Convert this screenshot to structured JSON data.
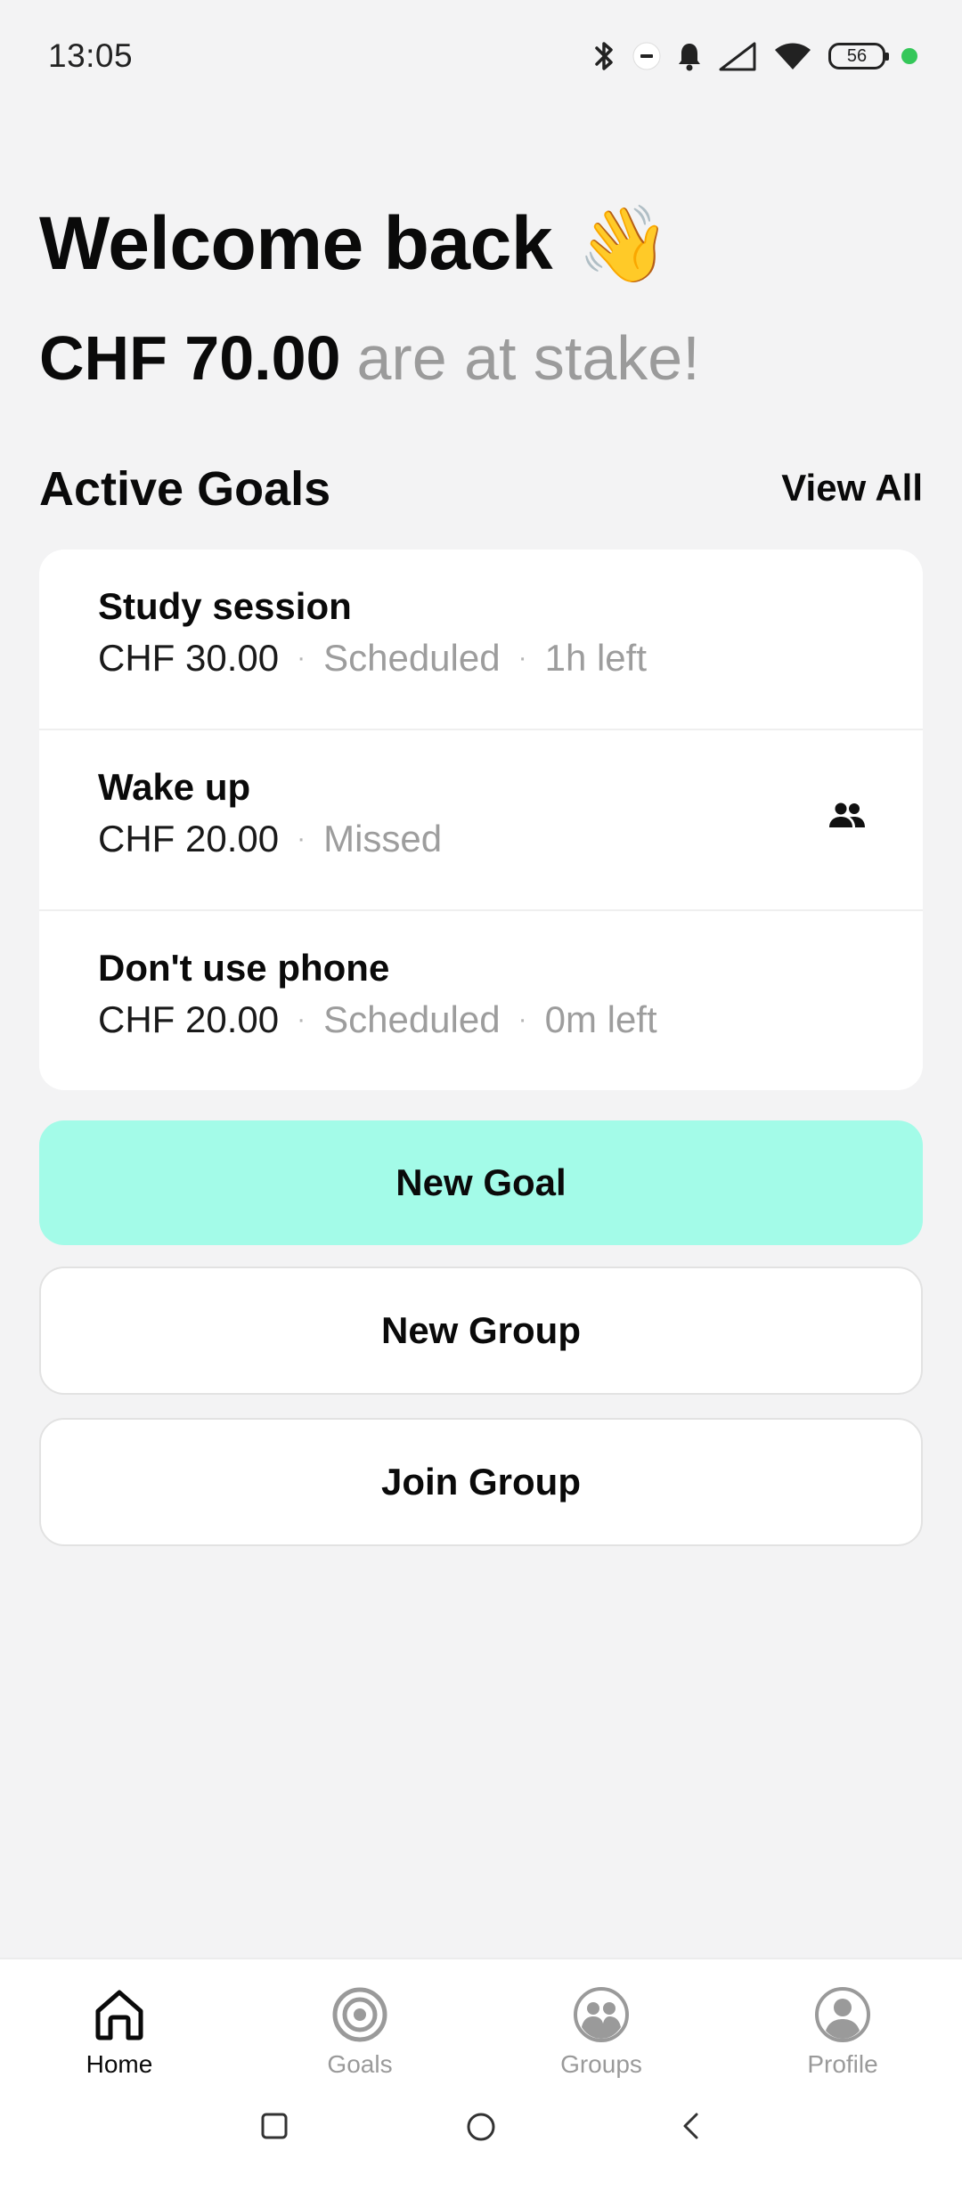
{
  "status_bar": {
    "time": "13:05",
    "battery": "56",
    "icons": [
      "bluetooth-icon",
      "do-not-disturb-icon",
      "notification-bell-icon",
      "signal-icon",
      "wifi-icon",
      "battery-icon"
    ]
  },
  "header": {
    "welcome": "Welcome back",
    "wave_emoji": "👋",
    "stake_amount": "CHF 70.00",
    "stake_text": "are at stake!"
  },
  "active_goals": {
    "title": "Active Goals",
    "view_all_label": "View All",
    "items": [
      {
        "title": "Study session",
        "amount": "CHF 30.00",
        "status": "Scheduled",
        "time_left": "1h left",
        "group": false
      },
      {
        "title": "Wake up",
        "amount": "CHF 20.00",
        "status": "Missed",
        "time_left": "",
        "group": true
      },
      {
        "title": "Don't use phone",
        "amount": "CHF 20.00",
        "status": "Scheduled",
        "time_left": "0m left",
        "group": false
      }
    ],
    "separator": "·"
  },
  "actions": {
    "new_goal": "New Goal",
    "new_group": "New Group",
    "join_group": "Join Group"
  },
  "colors": {
    "primary_button": "#a3fbe8",
    "background": "#f3f3f4",
    "muted_text": "#9d9d9d"
  },
  "bottom_nav": {
    "items": [
      {
        "label": "Home",
        "icon": "home-icon",
        "active": true
      },
      {
        "label": "Goals",
        "icon": "target-icon",
        "active": false
      },
      {
        "label": "Groups",
        "icon": "groups-icon",
        "active": false
      },
      {
        "label": "Profile",
        "icon": "profile-icon",
        "active": false
      }
    ]
  }
}
